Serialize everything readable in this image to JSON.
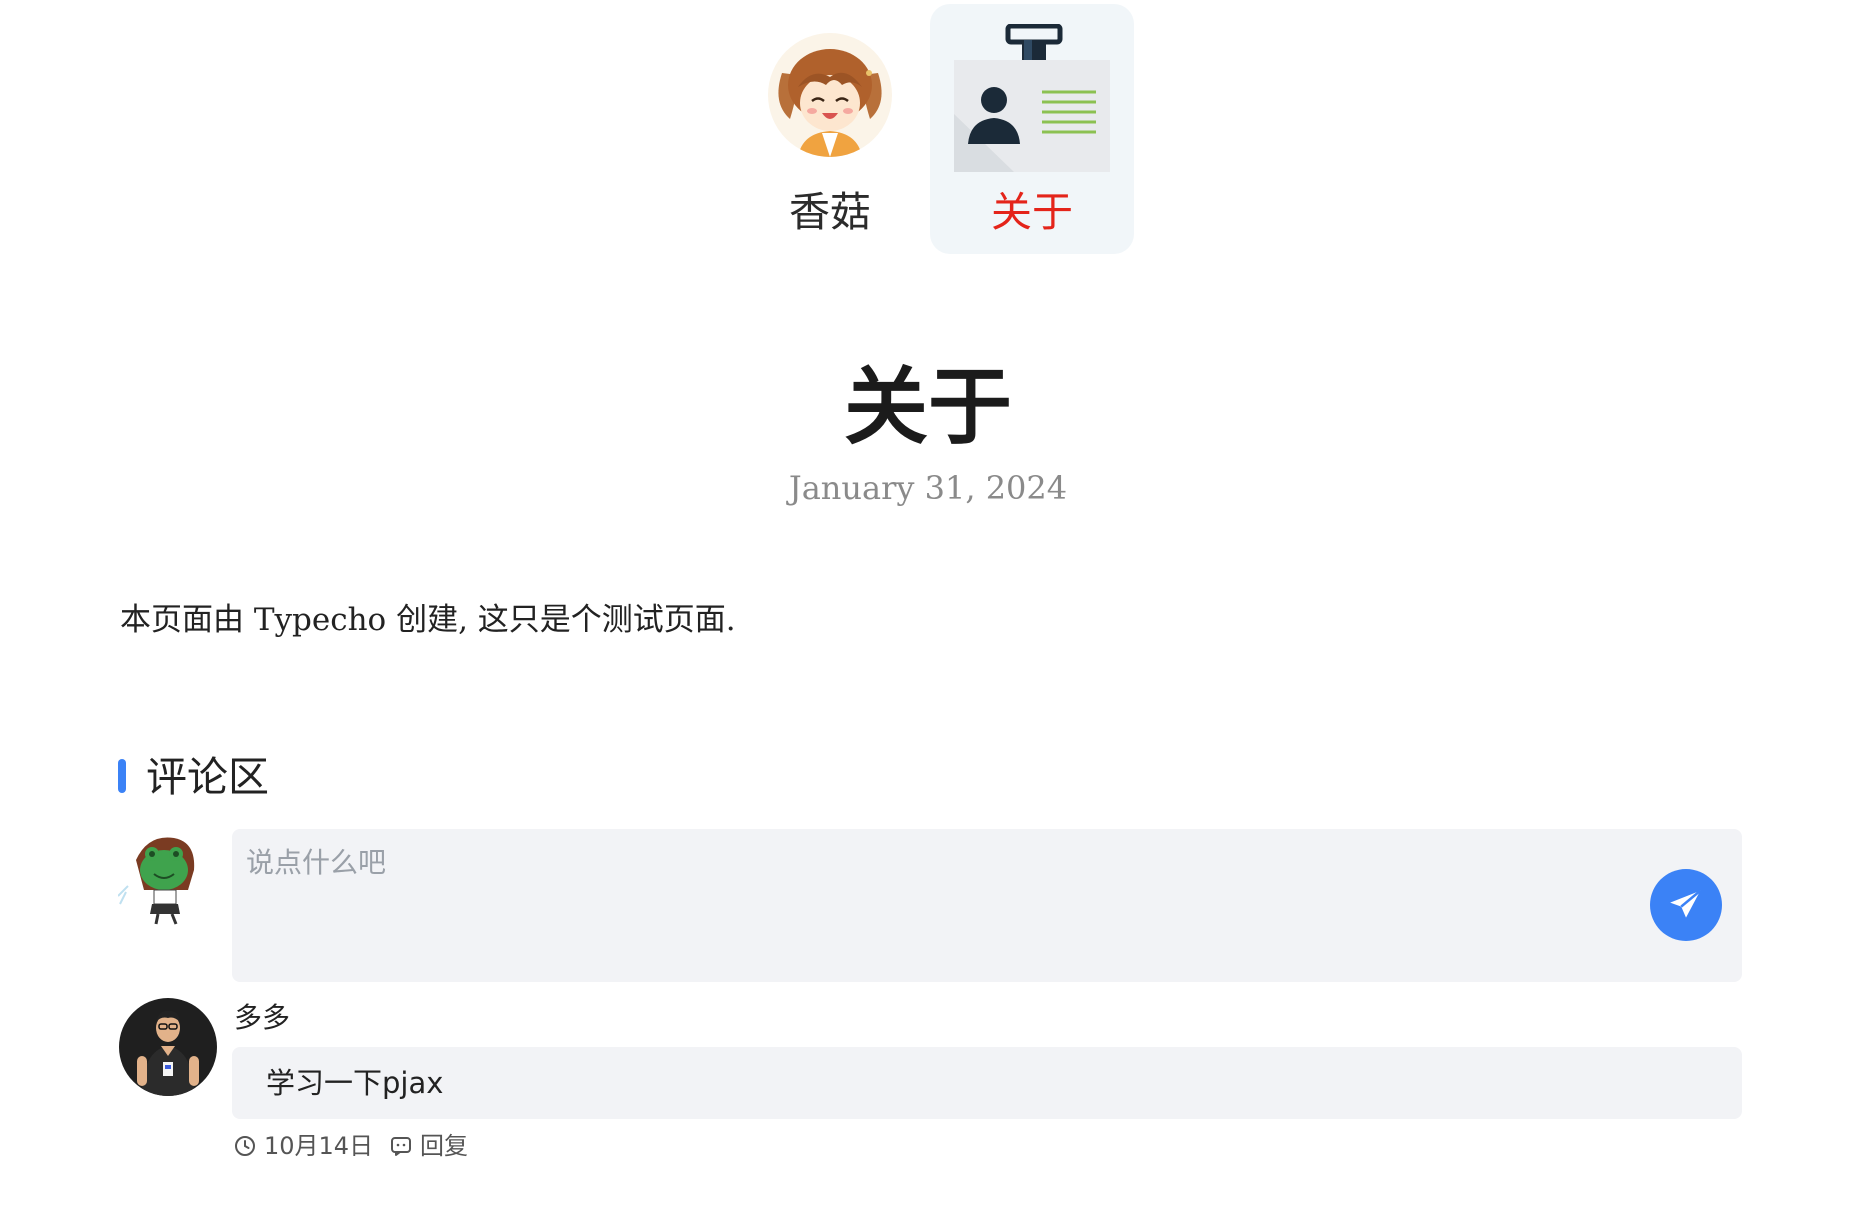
{
  "nav": {
    "items": [
      {
        "label": "香菇",
        "icon": "anime-avatar",
        "active": false
      },
      {
        "label": "关于",
        "icon": "id-card-icon",
        "active": true
      }
    ]
  },
  "article": {
    "title": "关于",
    "date": "January 31, 2024",
    "body": "本页面由 Typecho 创建, 这只是个测试页面."
  },
  "comments": {
    "heading": "评论区",
    "placeholder": "说点什么吧",
    "send_icon": "paper-plane-icon",
    "items": [
      {
        "author": "多多",
        "text": "学习一下pjax",
        "date": "10月14日",
        "reply_label": "回复"
      }
    ]
  },
  "colors": {
    "accent": "#3b82f6",
    "active_nav": "#e4241a",
    "bubble_bg": "#f2f3f6"
  }
}
